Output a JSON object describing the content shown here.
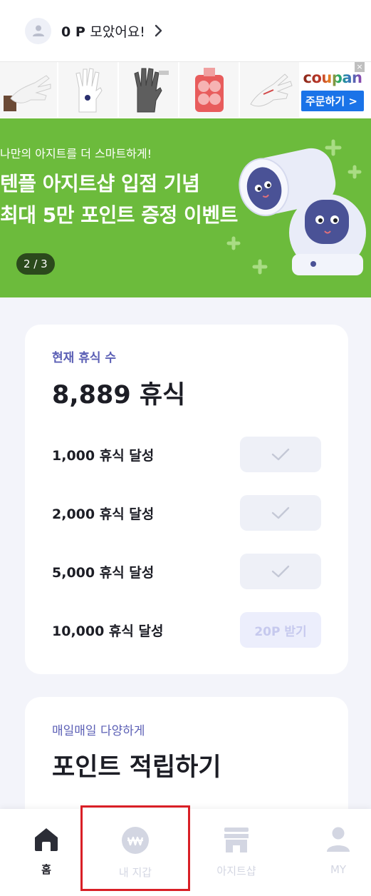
{
  "header": {
    "points_value": "0 P",
    "points_suffix": "모았어요!"
  },
  "ad": {
    "brand": "coupan",
    "button_label": "주문하기 >",
    "close": "×",
    "brand_letter_colors": [
      "#c0392b",
      "#e67e22",
      "#f1c40f",
      "#27ae60",
      "#2980b9",
      "#8e44ad"
    ]
  },
  "banner": {
    "subtitle": "나만의 아지트를 더 스마트하게!",
    "title_line1": "텐플 아지트샵 입점 기념",
    "title_line2": "최대 5만 포인트 증정 이벤트",
    "page_indicator": "2 / 3",
    "background_color": "#6cbb3c"
  },
  "rest_card": {
    "label": "현재 휴식 수",
    "count": "8,889 휴식",
    "milestones": [
      {
        "label": "1,000 휴식 달성",
        "status": "claimed"
      },
      {
        "label": "2,000 휴식 달성",
        "status": "claimed"
      },
      {
        "label": "5,000 휴식 달성",
        "status": "claimed"
      },
      {
        "label": "10,000 휴식 달성",
        "status": "available",
        "button": "20P 받기"
      }
    ]
  },
  "earn_card": {
    "label": "매일매일 다양하게",
    "title": "포인트 적립하기"
  },
  "bottom_nav": {
    "items": [
      {
        "label": "홈",
        "icon": "home-icon",
        "active": true
      },
      {
        "label": "내 지갑",
        "icon": "wallet-icon",
        "active": false
      },
      {
        "label": "아지트샵",
        "icon": "shop-icon",
        "active": false
      },
      {
        "label": "MY",
        "icon": "profile-icon",
        "active": false
      }
    ]
  },
  "colors": {
    "accent": "#5b5fb5",
    "highlight": "#d91f26"
  }
}
